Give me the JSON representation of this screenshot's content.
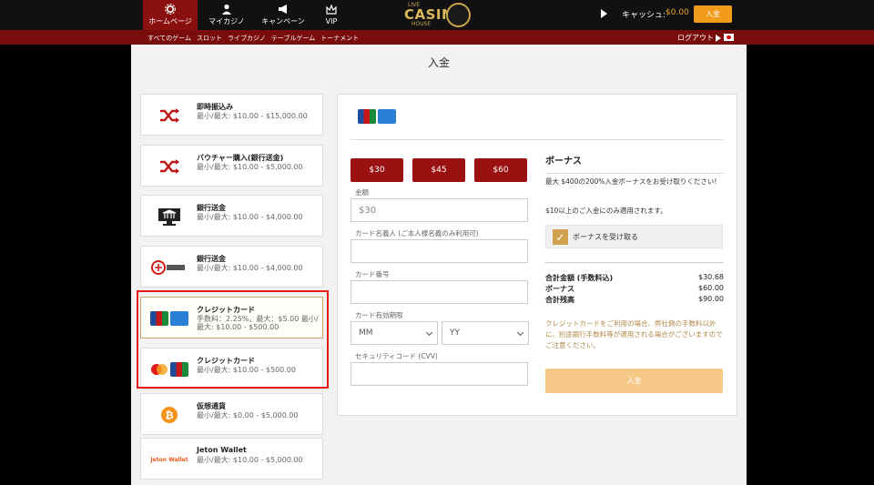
{
  "header": {
    "nav": [
      {
        "label": "ホームページ",
        "icon": "gear-icon"
      },
      {
        "label": "マイカジノ",
        "icon": "user-icon"
      },
      {
        "label": "キャンペーン",
        "icon": "megaphone-icon"
      },
      {
        "label": "VIP",
        "icon": "crown-icon"
      }
    ],
    "logo": {
      "top": "LIVE",
      "main": "CASINO",
      "bottom": "HOUSE"
    },
    "cash_label": "キャッシュ:",
    "cash_value": "$0.00",
    "deposit_label": "入金"
  },
  "subnav": {
    "items": [
      "すべてのゲーム",
      "スロット",
      "ライブカジノ",
      "テーブルゲーム",
      "トーナメント"
    ],
    "logout": "ログアウト"
  },
  "page": {
    "title": "入金"
  },
  "methods": [
    {
      "title": "即時振込み",
      "desc": "最小/最大: $10.00 - $15,000.00",
      "icon": "shuffle-icon"
    },
    {
      "title": "バウチャー購入(銀行送金)",
      "desc": "最小/最大: $10.00 - $5,000.00",
      "icon": "shuffle-icon"
    },
    {
      "title": "銀行送金",
      "desc": "最小/最大: $10.00 - $4,000.00",
      "icon": "bank-monitor-icon"
    },
    {
      "title": "銀行送金",
      "desc": "最小/最大: $10.00 - $4,000.00",
      "icon": "bank-transfer-icon"
    },
    {
      "title": "クレジットカード",
      "desc": "手数料：2.25%，最大：$5.00 最小/最大: $10.00 - $500.00",
      "icon": "jcb-amex-icon"
    },
    {
      "title": "クレジットカード",
      "desc": "最小/最大: $10.00 - $500.00",
      "icon": "mastercard-jcb-icon"
    },
    {
      "title": "仮想通貨",
      "desc": "最小/最大: $0.00 - $5,000.00",
      "icon": "bitcoin-icon"
    },
    {
      "title": "Jeton Wallet",
      "desc": "最小/最大: $10.00 - $5,000.00",
      "icon": "jeton-wallet-icon"
    }
  ],
  "jeton_logo_text": "Jeton Wallet",
  "form": {
    "amounts": [
      "$30",
      "$45",
      "$60"
    ],
    "amount_label": "金額",
    "amount_value": "$30",
    "name_label": "カード名義人 (ご本人様名義のみ利用可)",
    "number_label": "カード番号",
    "expiry_label": "カード有効期限",
    "month_value": "MM",
    "year_value": "YY",
    "cvv_label": "セキュリティコード (CVV)"
  },
  "bonus": {
    "title": "ボーナス",
    "desc": "最大 $400の200%入金ボーナスをお受け取りください!",
    "note": "$10以上のご入金にのみ適用されます。",
    "checkbox_label": "ボーナスを受け取る",
    "summary": [
      {
        "label": "合計金額 (手数料込)",
        "value": "$30.68"
      },
      {
        "label": "ボーナス",
        "value": "$60.00"
      },
      {
        "label": "合計残高",
        "value": "$90.00"
      }
    ],
    "fee_note": "クレジットカードをご利用の場合、弊社側の手数料以外に、別途銀行手数料等が適用される場合がございますのでご注意ください。",
    "submit_label": "入金"
  }
}
